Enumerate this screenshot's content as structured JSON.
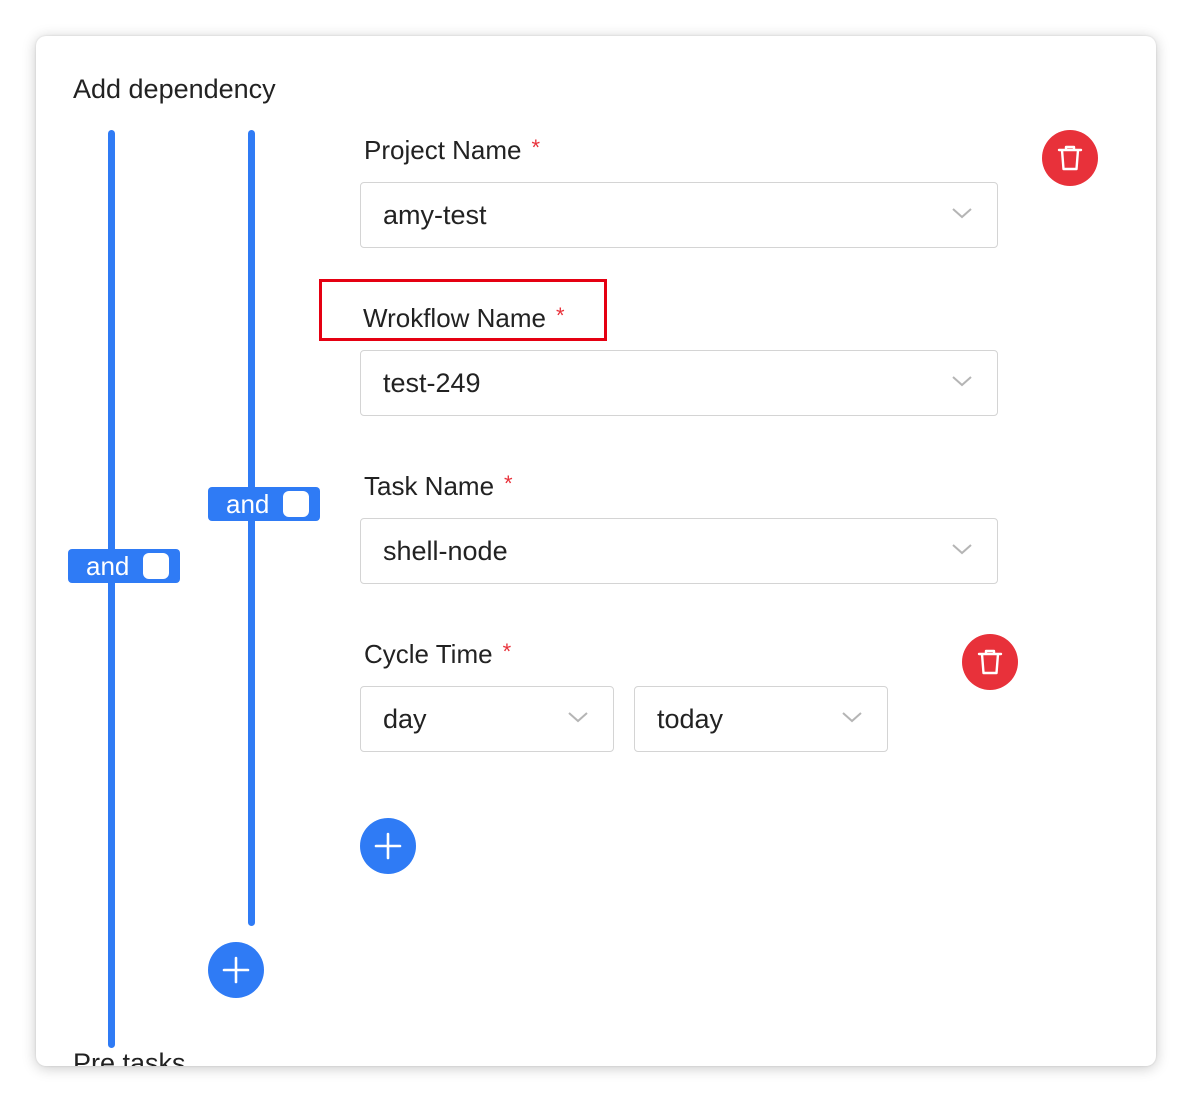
{
  "section": {
    "title": "Add dependency",
    "footer_label": "Pre tasks"
  },
  "relations": {
    "outer": "and",
    "inner": "and"
  },
  "form": {
    "project": {
      "label": "Project Name",
      "required_mark": "*",
      "value": "amy-test"
    },
    "workflow": {
      "label": "Wrokflow Name",
      "required_mark": "*",
      "value": "test-249"
    },
    "task": {
      "label": "Task Name",
      "required_mark": "*",
      "value": "shell-node"
    },
    "cycle": {
      "label": "Cycle Time",
      "required_mark": "*",
      "unit_value": "day",
      "date_value": "today"
    }
  },
  "icons": {
    "delete": "trash-icon",
    "add": "plus-icon",
    "dropdown": "chevron-down-icon"
  },
  "colors": {
    "accent": "#2f7bf5",
    "danger": "#e8313a",
    "highlight_box": "#e50012"
  }
}
